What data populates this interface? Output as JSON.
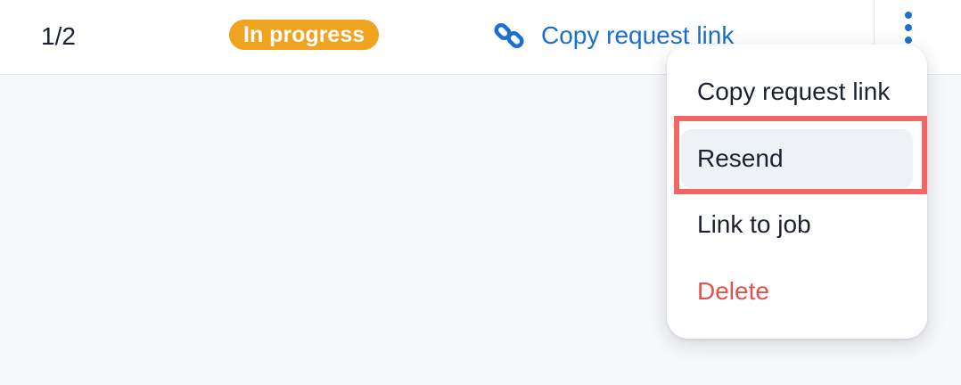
{
  "row": {
    "count": "1/2",
    "status_badge": "In progress",
    "copy_link_label": "Copy request link",
    "link_icon": "link-icon",
    "more_icon": "more-vertical-icon"
  },
  "menu": {
    "items": [
      {
        "label": "Copy request link",
        "state": "normal"
      },
      {
        "label": "Resend",
        "state": "hovered"
      },
      {
        "label": "Link to job",
        "state": "normal"
      },
      {
        "label": "Delete",
        "state": "danger"
      }
    ]
  },
  "colors": {
    "accent_blue": "#1a6fd0",
    "badge_orange": "#f0a31f",
    "danger_red": "#e0534f",
    "highlight_red": "#f26765",
    "hover_bg": "#eef1f6",
    "page_bg": "#f7f8fa"
  }
}
